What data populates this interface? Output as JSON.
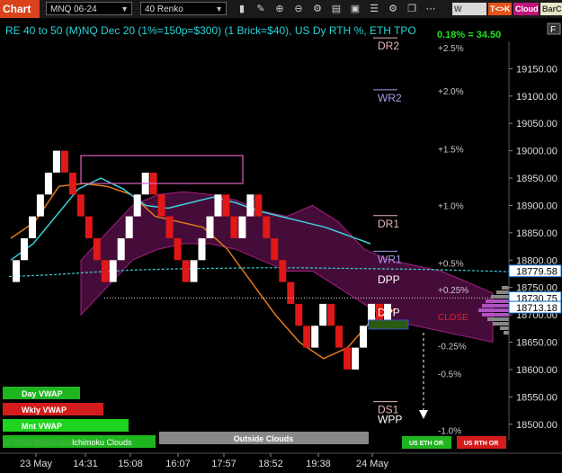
{
  "toolbar": {
    "app_label": "Chart",
    "instrument": "MNQ 06-24",
    "bar_type": "40 Renko",
    "buttons": {
      "vwap": "W VWAP",
      "tk": "T<>K",
      "cloud": "Cloud",
      "barcolor": "BarCo"
    },
    "icons": [
      "bar-chart-icon",
      "pencil-icon",
      "zoom-in-icon",
      "zoom-out-icon",
      "gear-icon",
      "properties-icon",
      "template-icon",
      "list-icon",
      "settings-icon",
      "copy-icon",
      "dots-icon"
    ]
  },
  "chart": {
    "title": "RE 40 to 50 (M)NQ Dec 20 (1%=150p=$300) (1 Brick=$40), US Dy RTH %, ETH TPO",
    "change": "0.18% = 34.50",
    "corner_button": "F",
    "level_labels": [
      {
        "text": "DR2",
        "price": 19185,
        "color": "#e6b8b8"
      },
      {
        "text": "WR2",
        "price": 19090,
        "color": "#a59be8"
      },
      {
        "text": "DR1",
        "price": 18860,
        "color": "#e6b8b8"
      },
      {
        "text": "WR1",
        "price": 18795,
        "color": "#a59be8"
      },
      {
        "text": "DPP",
        "price": 18758,
        "color": "#ffffff"
      },
      {
        "text": "DPP",
        "price": 18698,
        "color": "#ffffff"
      },
      {
        "text": "DS1",
        "price": 18520,
        "color": "#e6b8b8"
      },
      {
        "text": "WPP",
        "price": 18502,
        "color": "#ffffff"
      }
    ],
    "percent_labels": [
      {
        "text": "+2.5%",
        "price": 19182
      },
      {
        "text": "+2.0%",
        "price": 19103
      },
      {
        "text": "+1.5%",
        "price": 18997
      },
      {
        "text": "+1.0%",
        "price": 18893
      },
      {
        "text": "+0.5%",
        "price": 18788
      },
      {
        "text": "+0.25%",
        "price": 18740
      },
      {
        "text": "CLOSE",
        "price": 18690
      },
      {
        "text": "-0.25%",
        "price": 18637
      },
      {
        "text": "-0.5%",
        "price": 18586
      },
      {
        "text": "-1.0%",
        "price": 18482
      }
    ],
    "close_label": "CLOSE"
  },
  "chart_data": {
    "type": "line",
    "price_axis": {
      "ticks": [
        19150,
        19100,
        19050,
        19000,
        18950,
        18900,
        18850,
        18800,
        18750,
        18700,
        18650,
        18600,
        18550,
        18500
      ],
      "tick_labels": [
        "19150.00",
        "19100.00",
        "19050.00",
        "19000.00",
        "18950.00",
        "18900.00",
        "18850.00",
        "18800.00",
        "18750.00",
        "18700.00",
        "18650.00",
        "18600.00",
        "18550.00",
        "18500.00"
      ],
      "ylim": [
        18470,
        19200
      ],
      "price_markers": [
        {
          "label": "18779.58",
          "price": 18779.58,
          "style": "cyan"
        },
        {
          "label": "18730.75",
          "price": 18730.75,
          "style": "white"
        },
        {
          "label": "18713.18",
          "price": 18713.18,
          "style": "cyan"
        }
      ]
    },
    "time_axis": {
      "labels": [
        "23 May",
        "14:31",
        "15:08",
        "16:07",
        "17:57",
        "18:52",
        "19:38",
        "24 May"
      ]
    },
    "renko_close": [
      18800,
      18840,
      18880,
      18920,
      18960,
      19000,
      18960,
      18920,
      18880,
      18840,
      18800,
      18760,
      18800,
      18840,
      18880,
      18920,
      18960,
      18920,
      18880,
      18840,
      18800,
      18760,
      18800,
      18840,
      18880,
      18920,
      18880,
      18840,
      18880,
      18920,
      18880,
      18840,
      18800,
      18760,
      18720,
      18680,
      18640,
      18680,
      18720,
      18680,
      18640,
      18600,
      18640,
      18680,
      18720,
      18680,
      18720
    ],
    "renko_up": [
      true,
      true,
      true,
      true,
      true,
      true,
      false,
      false,
      false,
      false,
      false,
      false,
      true,
      true,
      true,
      true,
      true,
      false,
      false,
      false,
      false,
      false,
      true,
      true,
      true,
      true,
      false,
      false,
      true,
      true,
      false,
      false,
      false,
      false,
      false,
      false,
      false,
      true,
      true,
      false,
      false,
      false,
      true,
      true,
      true,
      false,
      true
    ],
    "brick_size": 40,
    "cyan_series": {
      "name": "",
      "values": [
        18800,
        18830,
        18880,
        18930,
        18950,
        18930,
        18900,
        18895,
        18905,
        18915,
        18905,
        18890,
        18880,
        18870,
        18860,
        18845,
        18830
      ]
    },
    "dashed_series": {
      "values": [
        18770,
        18773,
        18778,
        18782,
        18784,
        18785,
        18786,
        18786,
        18785,
        18784,
        18783,
        18781,
        18779
      ]
    },
    "orange_series": {
      "values": [
        18840,
        18870,
        18935,
        18940,
        18935,
        18920,
        18880,
        18870,
        18860,
        18820,
        18760,
        18700,
        18650,
        18620,
        18640,
        18690,
        18710
      ]
    },
    "cloud_upper": [
      18800,
      18850,
      18900,
      18920,
      18925,
      18920,
      18910,
      18890,
      18880,
      18900,
      18870,
      18820,
      18800,
      18790,
      18780,
      18760,
      18740
    ],
    "cloud_lower": [
      18700,
      18750,
      18800,
      18820,
      18830,
      18830,
      18820,
      18800,
      18780,
      18780,
      18750,
      18720,
      18690,
      18680,
      18670,
      18660,
      18650
    ]
  },
  "bottom": {
    "labels": [
      {
        "text": "Day VWAP",
        "color": "#1fb51f"
      },
      {
        "text": "Wkly VWAP",
        "color": "#d41c1c"
      },
      {
        "text": "Mnt VWAP",
        "color": "#1fd41f"
      }
    ],
    "copyright": "© 2024 NinjaTrader, LLC",
    "status": "Ichimoku Clouds",
    "gray_box": "Outside Clouds",
    "eth": "US ETH OR",
    "rth": "US RTH OR"
  }
}
